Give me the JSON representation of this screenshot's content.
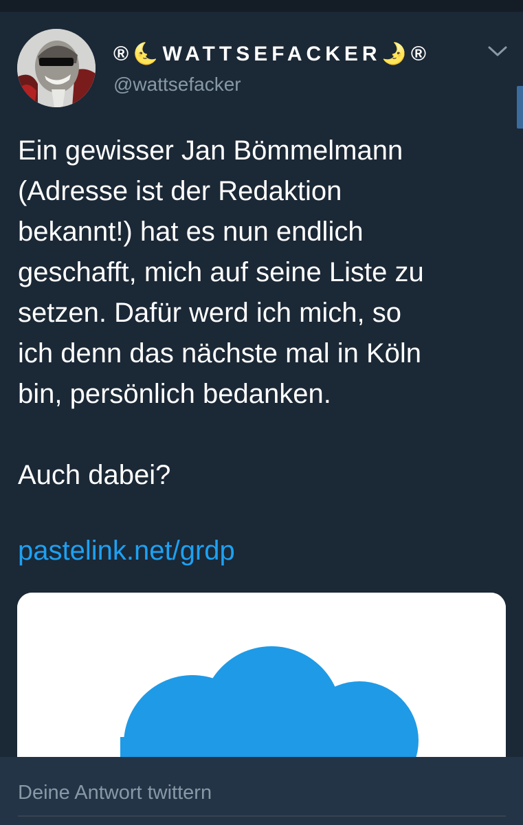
{
  "tweet": {
    "display_name": "®🌜WATTSEFACKER🌛®",
    "handle": "@wattsefacker",
    "text": "Ein gewisser Jan Bömmelmann\n(Adresse ist der Redaktion\nbekannt!) hat es nun endlich\ngeschafft, mich auf seine Liste zu\nsetzen. Dafür werd ich mich, so\nich denn das nächste mal in Köln\nbin, persönlich bedanken.\n\nAuch dabei?",
    "link": "pastelink.net/grdp",
    "avatar_icon": "avatar-image",
    "menu_icon": "chevron-down-icon",
    "card_image_icon": "cloud-icon"
  },
  "reply": {
    "placeholder": "Deine Antwort twittern"
  },
  "colors": {
    "background": "#1b2836",
    "text": "#ffffff",
    "secondary_text": "#8899a6",
    "link": "#1da1f2",
    "cloud": "#1f9ae6",
    "reply_bar": "#243447"
  }
}
